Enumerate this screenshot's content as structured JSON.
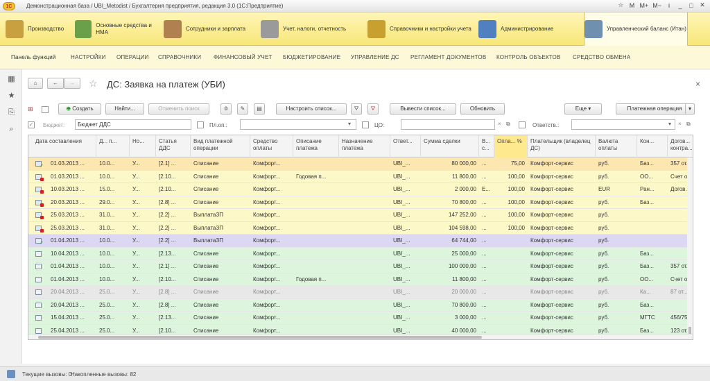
{
  "titlebar": {
    "logo_label": "1С",
    "title": "Демонстрационная база / UBI_Metodist / Бухгалтерия предприятия, редакция 3.0  (1С:Предприятие)",
    "controls": [
      "☆",
      "M",
      "M+",
      "M−",
      "i",
      "_",
      "□",
      "✕"
    ]
  },
  "sections": [
    {
      "label": "Производство",
      "icon": "factory-icon",
      "color": "#c9a040"
    },
    {
      "label": "Основные средства и НМА",
      "icon": "assets-icon",
      "color": "#6aa04a"
    },
    {
      "label": "Сотрудники и зарплата",
      "icon": "people-icon",
      "color": "#b08050"
    },
    {
      "label": "Учет, налоги, отчетность",
      "icon": "calculator-icon",
      "color": "#9a9a9a"
    },
    {
      "label": "Справочники и настройки учета",
      "icon": "books-icon",
      "color": "#c8a030"
    },
    {
      "label": "Администрирование",
      "icon": "computer-icon",
      "color": "#5080c0"
    },
    {
      "label": "Управленческий баланс (Итан)",
      "icon": "balance-icon",
      "color": "#7090b0"
    }
  ],
  "funcbar": {
    "panel_label": "Панель функций",
    "items": [
      "НАСТРОЙКИ",
      "ОПЕРАЦИИ",
      "СПРАВОЧНИКИ",
      "ФИНАНСОВЫЙ УЧЕТ",
      "БЮДЖЕТИРОВАНИЕ",
      "УПРАВЛЕНИЕ ДС",
      "РЕГЛАМЕНТ ДОКУМЕНТОВ",
      "КОНТРОЛЬ ОБЪЕКТОВ",
      "СРЕДСТВО ОБМЕНА"
    ]
  },
  "lefttb": {
    "icons": [
      "grid-icon",
      "star-icon",
      "history-icon",
      "search-icon"
    ]
  },
  "form": {
    "title": "ДС: Заявка на платеж (УБИ)",
    "close": "×",
    "buttons": {
      "create": "Создать",
      "find": "Найти...",
      "cancel_search": "Отменить поиск",
      "configure": "Настроить список...",
      "output": "Вывести список...",
      "refresh": "Обновить",
      "more": "Еще",
      "payment_op": "Платежная операция"
    },
    "filters": {
      "budget_label": "Бюджет:",
      "budget_value": "Бюджет ДДС",
      "plop_label": "Пл.оп.:",
      "co_label": "ЦО:",
      "resp_label": "Ответств.:"
    }
  },
  "table": {
    "columns": [
      "Дата составления",
      "Д... п...",
      "Но...",
      "Статья ДДС",
      "Вид платежной операции",
      "Средство оплаты",
      "Описание платежа",
      "Назначение платежа",
      "Ответ...",
      "Сумма сделки",
      "В... с...",
      "Опла... %",
      "Плательщик (владелец ДС)",
      "Валюта оплаты",
      "Кон...",
      "Догов... контра..."
    ],
    "rows": [
      {
        "status": "check",
        "bg": "#fce7b0",
        "cells": [
          "01.03.2013 ...",
          "10.0...",
          "У...",
          "[2.1] ...",
          "Списание",
          "Комфорт...",
          "",
          "",
          "UBI_...",
          "80 000,00",
          "...",
          "75,00",
          "Комфорт-сервис",
          "руб.",
          "Баз...",
          "357 от..."
        ]
      },
      {
        "status": "lock",
        "bg": "#fdf8c8",
        "cells": [
          "01.03.2013 ...",
          "10.0...",
          "У...",
          "[2.10...",
          "Списание",
          "Комфорт...",
          "Годовая п...",
          "",
          "UBI_...",
          "11 800,00",
          "...",
          "100,00",
          "Комфорт-сервис",
          "руб.",
          "ОО...",
          "Счет о..."
        ]
      },
      {
        "status": "lock",
        "bg": "#fdf8c8",
        "cells": [
          "10.03.2013 ...",
          "15.0...",
          "У...",
          "[2.10...",
          "Списание",
          "Комфорт...",
          "",
          "",
          "UBI_...",
          "2 000,00",
          "Е...",
          "100,00",
          "Комфорт-сервис",
          "EUR",
          "Ран...",
          "Догов..."
        ]
      },
      {
        "status": "lock",
        "bg": "#fdf8c8",
        "cells": [
          "20.03.2013 ...",
          "29.0...",
          "У...",
          "[2.8] ...",
          "Списание",
          "Комфорт...",
          "",
          "",
          "UBI_...",
          "70 800,00",
          "...",
          "100,00",
          "Комфорт-сервис",
          "руб.",
          "Баз...",
          ""
        ]
      },
      {
        "status": "lock",
        "bg": "#fdf8c8",
        "cells": [
          "25.03.2013 ...",
          "31.0...",
          "У...",
          "[2.2] ...",
          "ВыплатаЗП",
          "Комфорт...",
          "",
          "",
          "UBI_...",
          "147 252,00",
          "...",
          "100,00",
          "Комфорт-сервис",
          "руб.",
          "",
          ""
        ]
      },
      {
        "status": "lock",
        "bg": "#fdf8c8",
        "cells": [
          "25.03.2013 ...",
          "31.0...",
          "У...",
          "[2.2] ...",
          "ВыплатаЗП",
          "Комфорт...",
          "",
          "",
          "UBI_...",
          "104 598,00",
          "...",
          "100,00",
          "Комфорт-сервис",
          "руб.",
          "",
          ""
        ]
      },
      {
        "status": "check",
        "bg": "#dcd8f4",
        "cells": [
          "01.04.2013 ...",
          "10.0...",
          "У...",
          "[2.2] ...",
          "ВыплатаЗП",
          "Комфорт...",
          "",
          "",
          "UBI_...",
          "64 744,00",
          "...",
          "",
          "Комфорт-сервис",
          "руб.",
          "",
          ""
        ]
      },
      {
        "status": "doc",
        "bg": "#dcf5dc",
        "cells": [
          "10.04.2013 ...",
          "10.0...",
          "У...",
          "[2.13...",
          "Списание",
          "Комфорт...",
          "",
          "",
          "UBI_...",
          "25 000,00",
          "...",
          "",
          "Комфорт-сервис",
          "руб.",
          "Баз...",
          ""
        ]
      },
      {
        "status": "doc",
        "bg": "#dcf5dc",
        "cells": [
          "01.04.2013 ...",
          "10.0...",
          "У...",
          "[2.1] ...",
          "Списание",
          "Комфорт...",
          "",
          "",
          "UBI_...",
          "100 000,00",
          "...",
          "",
          "Комфорт-сервис",
          "руб.",
          "Баз...",
          "357 от..."
        ]
      },
      {
        "status": "doc",
        "bg": "#dcf5dc",
        "cells": [
          "01.04.2013 ...",
          "10.0...",
          "У...",
          "[2.10...",
          "Списание",
          "Комфорт...",
          "Годовая п...",
          "",
          "UBI_...",
          "11 800,00",
          "...",
          "",
          "Комфорт-сервис",
          "руб.",
          "ОО...",
          "Счет о..."
        ]
      },
      {
        "status": "doc",
        "bg": "#e8e8e8",
        "muted": true,
        "cells": [
          "20.04.2013 ...",
          "25.0...",
          "У...",
          "[2.8] ...",
          "Списание",
          "Комфорт...",
          "",
          "",
          "UBI_...",
          "20 000,00",
          "...",
          "",
          "Комфорт-сервис",
          "руб.",
          "Ка...",
          "87 от..."
        ]
      },
      {
        "status": "doc",
        "bg": "#dcf5dc",
        "cells": [
          "20.04.2013 ...",
          "25.0...",
          "У...",
          "[2.8] ...",
          "Списание",
          "Комфорт...",
          "",
          "",
          "UBI_...",
          "70 800,00",
          "...",
          "",
          "Комфорт-сервис",
          "руб.",
          "Баз...",
          ""
        ]
      },
      {
        "status": "doc",
        "bg": "#dcf5dc",
        "cells": [
          "15.04.2013 ...",
          "25.0...",
          "У...",
          "[2.13...",
          "Списание",
          "Комфорт...",
          "",
          "",
          "UBI_...",
          "3 000,00",
          "...",
          "",
          "Комфорт-сервис",
          "руб.",
          "МГТС",
          "456/75..."
        ]
      },
      {
        "status": "doc",
        "bg": "#dcf5dc",
        "cells": [
          "25.04.2013 ...",
          "25.0...",
          "У...",
          "[2.10...",
          "Списание",
          "Комфорт...",
          "",
          "",
          "UBI_...",
          "40 000,00",
          "...",
          "",
          "Комфорт-сервис",
          "руб.",
          "Баз...",
          "123 от..."
        ]
      }
    ]
  },
  "statusbar": {
    "current_calls": "Текущие вызовы: 0",
    "accumulated_calls": "Накопленные вызовы: 82"
  }
}
